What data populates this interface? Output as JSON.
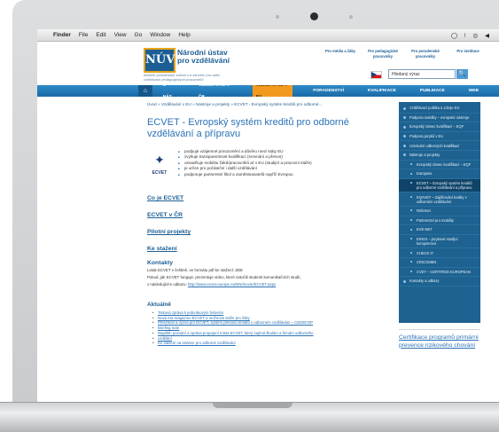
{
  "menubar": {
    "apple": "",
    "items": [
      "Finder",
      "File",
      "Edit",
      "View",
      "Go",
      "Window",
      "Help"
    ],
    "status": "◯ ! ◎ ◀"
  },
  "header": {
    "logo_text": "NÚV",
    "inst_name_line1": "Národní ústav",
    "inst_name_line2": "pro vzdělávání",
    "inst_subtitle": "školské poradenské zařízení a zařízení pro další vzdělávání pedagogických pracovníků",
    "top_links": [
      "Pro média a žáky",
      "Pro pedagogické pracovníky",
      "Pro poradenské pracovníky",
      "Pro instituce"
    ],
    "search": {
      "value": "Hledaný výraz",
      "button": "🔍"
    }
  },
  "nav": {
    "home_icon": "⌂",
    "items": [
      "O NÁS",
      "VZDĚLÁVÁNÍ V ČR",
      "VZDĚLÁVÁNÍ A EU",
      "PORADENSTVÍ",
      "KVALIFIKACE",
      "PUBLIKACE",
      "WEB"
    ],
    "active_index": 2
  },
  "content": {
    "breadcrumb": "Úvod » Vzdělávání v EU » Nástroje a projekty » ECVET - Evropský systém kreditů pro odborné...",
    "title": "ECVET - Evropský systém kreditů pro odborné vzdělávání a přípravu",
    "logo_label": "ECVET",
    "bullets": [
      "podpuje vzájemné porozumění a důvěru mezi státy EU",
      "zvyšuje transparentnost kvalifikací (srovnání a přenos)",
      "usnadňuje mobilitu žáků/pracovníků ať v EU (studijní a pracovní stáže)",
      "je určen pro počáteční i další vzdělávání",
      "podporuje partnerství škol a zaměstnavatelů napříč Evropou"
    ],
    "links": [
      "Co je ECVET",
      "ECVET v ČR",
      "Pilotní projekty",
      "Ke stažení"
    ],
    "contacts_heading": "Kontakty",
    "contacts_p1": "Letak ECVET v češtině, ve formátu pdf ke stažení: ZDE",
    "contacts_p2": "Pokud, jak ECVET funguje, prezentuje video, které natočili studenti komunikačních studií,",
    "contacts_p3_text": "v následujícím odkazu: ",
    "contacts_p3_link": "http://www.ecvet-europe.eu/EN/movie/ECVET.aspx",
    "news_heading": "Aktuálně",
    "news": [
      "Tisková zpráva k jednotkovým řešením",
      "Nová éra magazínu ECVET a možnosti stáže pro žáky",
      "Příležitost a výzva pro ECVET, systém přenosu kreditů v odborném vzdělávání – CEDEFOP",
      "Briefing note",
      "Napiště: pozvání a zpráva propojení místa ECVET, který zajímá školám a firmám odborného",
      "vzdělání",
      "Ke stažení na stránce pro odborné vzdělávání"
    ]
  },
  "sidebar": {
    "items": [
      {
        "label": "Vzdělávací politika a zdroje EU",
        "sub": false
      },
      {
        "label": "Podpora mobility – evropské nástroje",
        "sub": false
      },
      {
        "label": "Evropský rámec kvalifikací – EQF",
        "sub": false
      },
      {
        "label": "Podpora jazyků v EU",
        "sub": false
      },
      {
        "label": "Uznávání odborných kvalifikací",
        "sub": false
      },
      {
        "label": "Nástroje a projekty",
        "sub": false
      },
      {
        "label": "Evropský rámec kvalifikací – EQF",
        "sub": true
      },
      {
        "label": "Europass",
        "sub": true
      },
      {
        "label": "ECVET – Evropský systém kreditů pro odborné vzdělávání a přípravu",
        "sub": true
      },
      {
        "label": "EQAVET – Zajišťování kvality v odborném vzdělávání",
        "sub": true
      },
      {
        "label": "Refernet",
        "sub": true
      },
      {
        "label": "Partnerství pro mobility",
        "sub": true
      },
      {
        "label": "EVE-NET",
        "sub": true
      },
      {
        "label": "EKKIS – jazykové studijní kompetence",
        "sub": true
      },
      {
        "label": "CHECK IT",
        "sub": true
      },
      {
        "label": "CRICOMEN",
        "sub": true
      },
      {
        "label": "CVET – CERTIFIED EUROPEAN",
        "sub": true
      },
      {
        "label": "Kontakty a odkazy",
        "sub": false
      }
    ],
    "active_index": 8
  },
  "promo": {
    "text": "Certifikace programů primární prevence rizikového chování"
  }
}
